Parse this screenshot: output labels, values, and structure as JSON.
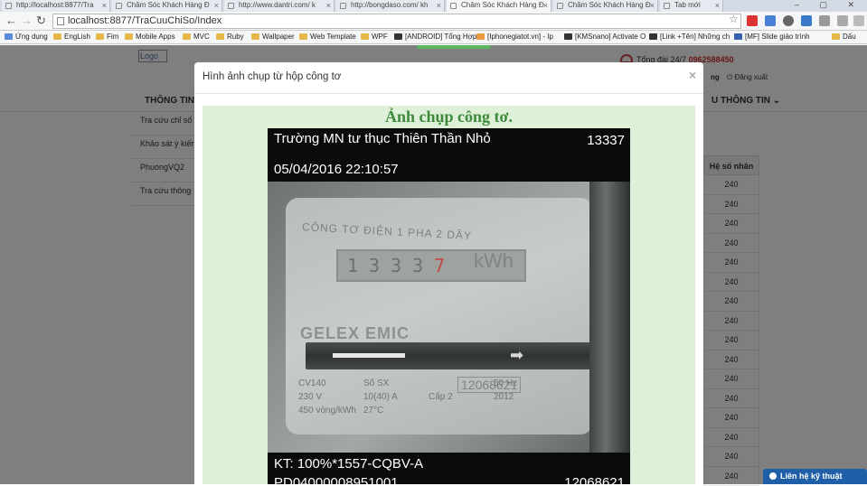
{
  "browser": {
    "tabs": [
      {
        "label": "http://localhost:8877/Tra"
      },
      {
        "label": "Chăm Sóc Khách Hàng Đ"
      },
      {
        "label": "http://www.dantri.com/ k"
      },
      {
        "label": "http://bongdaso.com/ kh"
      },
      {
        "label": "Chăm Sóc Khách Hàng Đ"
      },
      {
        "label": "Chăm Sóc Khách Hàng Đ"
      },
      {
        "label": "Tab mới"
      }
    ],
    "url": "localhost:8877/TraCuuChiSo/Index",
    "bookmarks": [
      {
        "label": "Ứng dụng"
      },
      {
        "label": "EngLish"
      },
      {
        "label": "Fim"
      },
      {
        "label": "Mobile Apps"
      },
      {
        "label": "MVC"
      },
      {
        "label": "Ruby"
      },
      {
        "label": "Wallpaper"
      },
      {
        "label": "Web Template"
      },
      {
        "label": "WPF"
      },
      {
        "label": "[ANDROID] Tổng Hợp"
      },
      {
        "label": "[Iphonegiatot.vn] - Ip"
      },
      {
        "label": "[KMSnano] Activate O"
      },
      {
        "label": "[Link +Tên] Những ch"
      },
      {
        "label": "[MF] Slide giáo trình"
      },
      {
        "label": "Dấu"
      }
    ]
  },
  "site": {
    "logo_alt": "Logo",
    "hotline_label": "Tổng đài 24/7",
    "hotline_number": "0962588450",
    "user_short": "ng",
    "logout": "Đăng xuất",
    "nav_left": "THÔNG TIN",
    "nav_right": "U THÔNG TIN",
    "left_menu": [
      {
        "label": "Tra cứu chỉ số"
      },
      {
        "label": "Khảo sát ý kiến"
      },
      {
        "label": "PhuongVQ2"
      },
      {
        "label": "Tra cứu thông"
      }
    ],
    "table": {
      "header": "Hệ số nhân",
      "values": [
        "240",
        "240",
        "240",
        "240",
        "240",
        "240",
        "240",
        "240",
        "240",
        "240",
        "240",
        "240",
        "240",
        "240",
        "240",
        "240"
      ]
    },
    "support_button": "Liên hệ kỹ thuật"
  },
  "modal": {
    "title": "Hình ảnh chụp từ hộp công tơ",
    "close": "×",
    "heading": "Ảnh chụp công tơ.",
    "overlay_top_left": "Trường MN tư thục Thiên Thần Nhỏ",
    "overlay_top_right": "13337",
    "overlay_datetime": "05/04/2016 22:10:57",
    "overlay_bottom_1": "KT: 100%*1557-CQBV-A",
    "overlay_bottom_2_left": "PD04000008951001",
    "overlay_bottom_2_right": "12068621",
    "meter": {
      "title": "CÔNG TƠ ĐIỆN 1 PHA 2 DÂY",
      "reading_digits": "1333",
      "reading_red_digit": "7",
      "unit": "kWh",
      "brand": "GELEX EMIC",
      "model": "CV140",
      "voltage": "230 V",
      "constant": "450 vòng/kWh",
      "current": "10(40) A",
      "freq": "50 Hz",
      "temp": "27°C",
      "class": "Cấp 2",
      "year": "2012",
      "serial_label": "Số SX",
      "serial": "12068621"
    }
  }
}
